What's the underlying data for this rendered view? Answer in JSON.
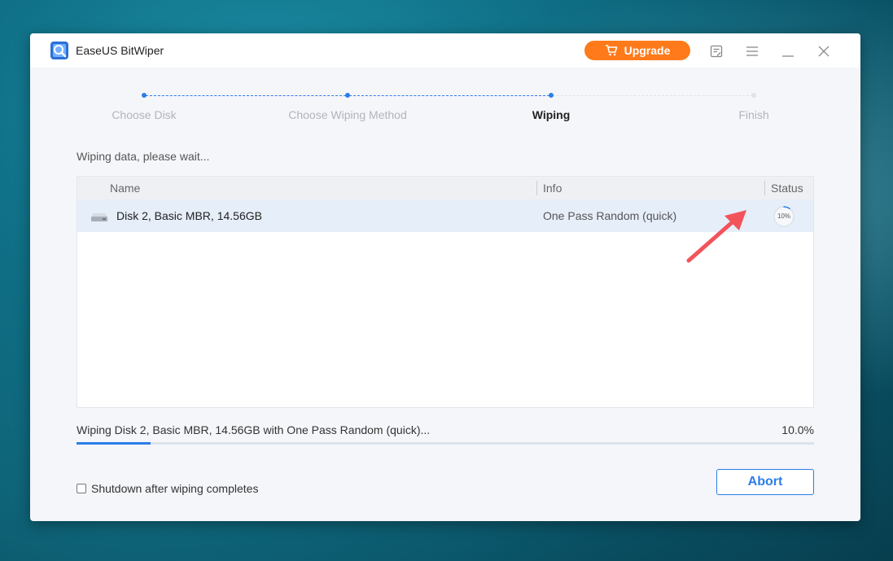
{
  "window": {
    "title": "EaseUS BitWiper",
    "upgrade_label": "Upgrade",
    "icons": [
      "feedback-icon",
      "menu-icon",
      "minimize-icon",
      "close-icon"
    ]
  },
  "stepper": {
    "steps": [
      {
        "label": "Choose Disk",
        "state": "done"
      },
      {
        "label": "Choose Wiping Method",
        "state": "done"
      },
      {
        "label": "Wiping",
        "state": "active"
      },
      {
        "label": "Finish",
        "state": "pending"
      }
    ]
  },
  "main": {
    "status_text": "Wiping data, please wait...",
    "table": {
      "columns": [
        "Name",
        "Info",
        "Status"
      ],
      "rows": [
        {
          "name": "Disk 2, Basic MBR, 14.56GB",
          "info": "One Pass Random (quick)",
          "status": "10%",
          "status_fraction": 0.1
        }
      ]
    },
    "progress": {
      "label": "Wiping Disk 2, Basic MBR, 14.56GB with One Pass Random (quick)...",
      "percent_text": "10.0%",
      "percent": 10.0
    },
    "shutdown_label": "Shutdown after wiping completes",
    "shutdown_checked": false,
    "abort_label": "Abort"
  },
  "colors": {
    "accent": "#2b7de9",
    "upgrade": "#ff7a1a",
    "annotation_arrow": "#f2545b"
  }
}
